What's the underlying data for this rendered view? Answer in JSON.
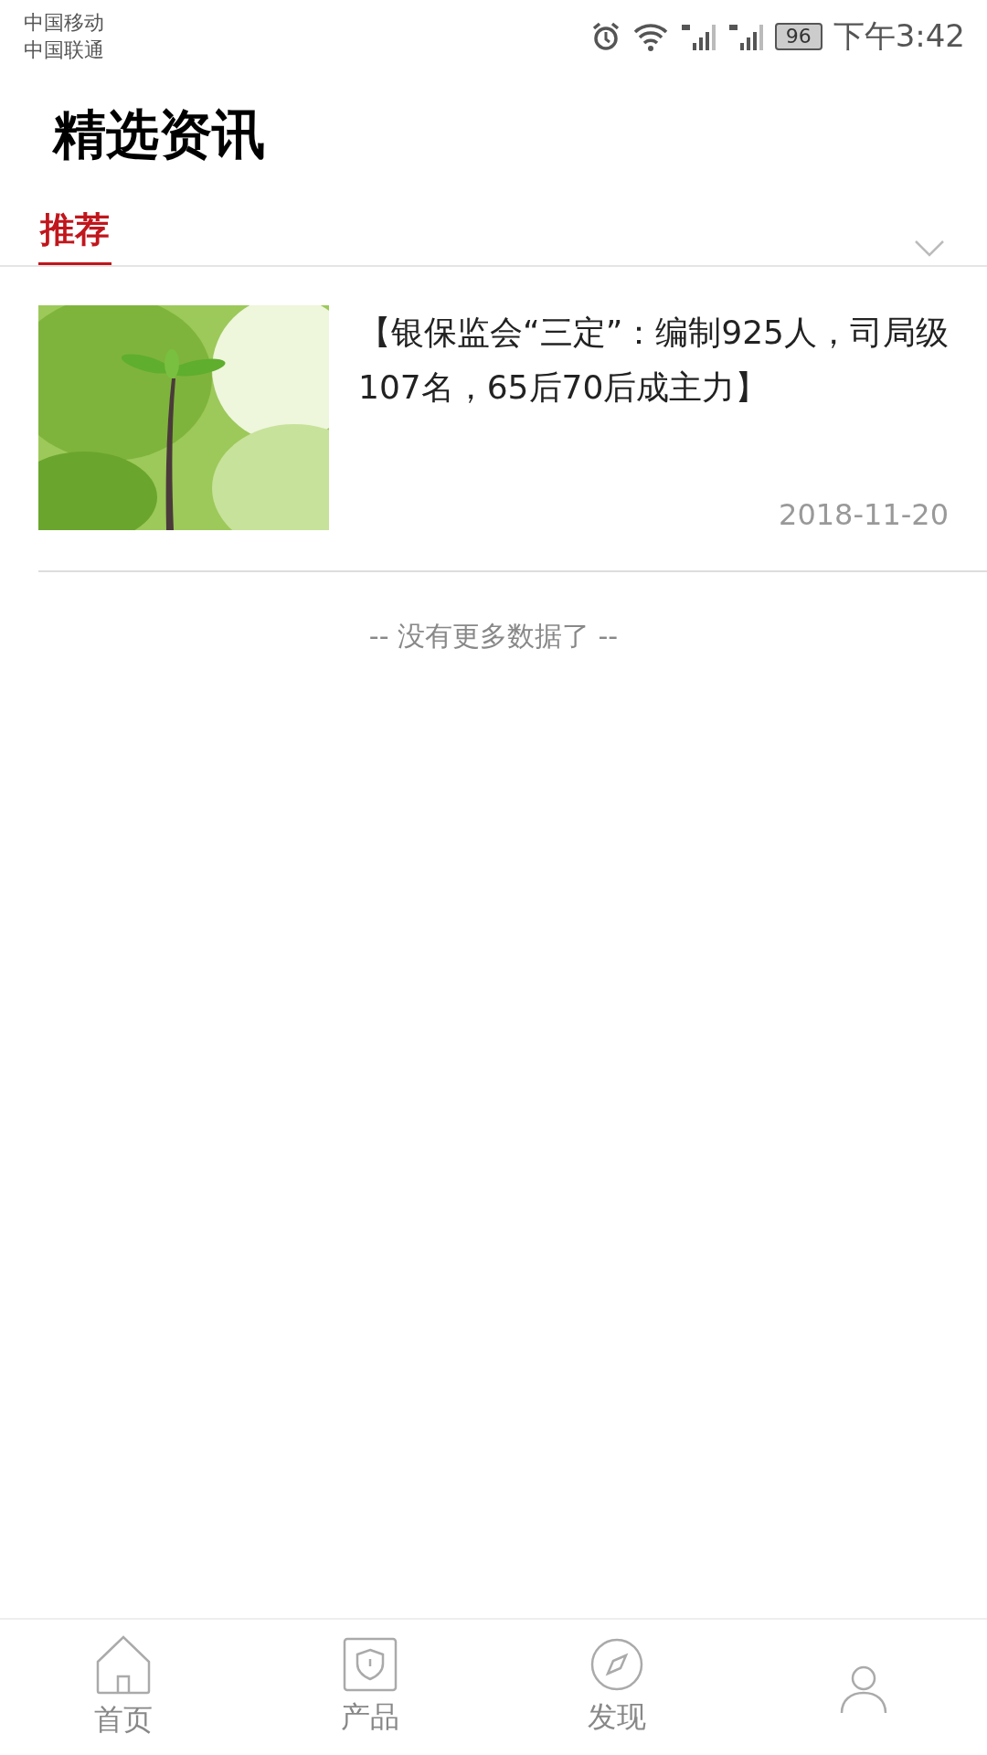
{
  "status_bar": {
    "carriers": [
      "中国移动",
      "中国联通"
    ],
    "battery": "96",
    "time": "下午3:42"
  },
  "page_title": "精选资讯",
  "tabs": [
    {
      "label": "推荐",
      "selected": true
    }
  ],
  "articles": [
    {
      "kind": "picture",
      "title": "【银保监会“三定”：编制925人，司局级107名，65后70后成主力】",
      "date": "2018-11-20"
    }
  ],
  "end_note": "-- 没有更多数据了 --",
  "bottom_nav": [
    {
      "kind": "home",
      "label": "首页",
      "selected": false
    },
    {
      "kind": "product",
      "label": "产品",
      "selected": false
    },
    {
      "kind": "discover",
      "label": "发现",
      "selected": false
    },
    {
      "kind": "profile",
      "selected": false
    }
  ]
}
